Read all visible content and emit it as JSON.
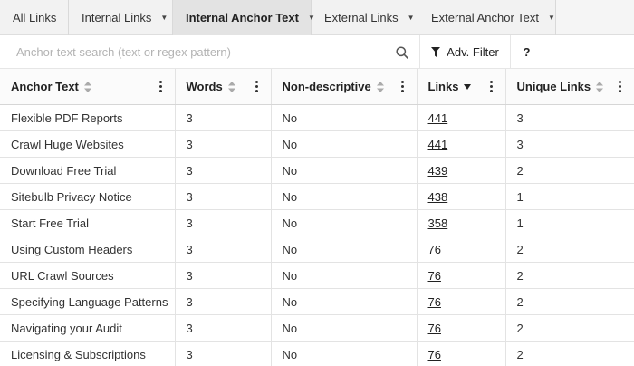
{
  "tabs": [
    {
      "label": "All Links",
      "has_dropdown": false,
      "active": false
    },
    {
      "label": "Internal Links",
      "has_dropdown": true,
      "active": false
    },
    {
      "label": "Internal Anchor Text",
      "has_dropdown": true,
      "active": true
    },
    {
      "label": "External Links",
      "has_dropdown": true,
      "active": false
    },
    {
      "label": "External Anchor Text",
      "has_dropdown": true,
      "active": false
    }
  ],
  "search": {
    "placeholder": "Anchor text search (text or regex pattern)",
    "value": ""
  },
  "toolbar": {
    "filter_label": "Adv. Filter",
    "help_label": "?"
  },
  "table": {
    "columns": [
      {
        "label": "Anchor Text",
        "sort": "none"
      },
      {
        "label": "Words",
        "sort": "none"
      },
      {
        "label": "Non-descriptive",
        "sort": "none"
      },
      {
        "label": "Links",
        "sort": "desc"
      },
      {
        "label": "Unique Links",
        "sort": "none"
      }
    ],
    "rows": [
      {
        "anchor": "Flexible PDF Reports",
        "words": "3",
        "nondesc": "No",
        "links": "441",
        "unique": "3"
      },
      {
        "anchor": "Crawl Huge Websites",
        "words": "3",
        "nondesc": "No",
        "links": "441",
        "unique": "3"
      },
      {
        "anchor": "Download Free Trial",
        "words": "3",
        "nondesc": "No",
        "links": "439",
        "unique": "2"
      },
      {
        "anchor": "Sitebulb Privacy Notice",
        "words": "3",
        "nondesc": "No",
        "links": "438",
        "unique": "1"
      },
      {
        "anchor": "Start Free Trial",
        "words": "3",
        "nondesc": "No",
        "links": "358",
        "unique": "1"
      },
      {
        "anchor": "Using Custom Headers",
        "words": "3",
        "nondesc": "No",
        "links": "76",
        "unique": "2"
      },
      {
        "anchor": "URL Crawl Sources",
        "words": "3",
        "nondesc": "No",
        "links": "76",
        "unique": "2"
      },
      {
        "anchor": "Specifying Language Patterns",
        "words": "3",
        "nondesc": "No",
        "links": "76",
        "unique": "2"
      },
      {
        "anchor": "Navigating your Audit",
        "words": "3",
        "nondesc": "No",
        "links": "76",
        "unique": "2"
      },
      {
        "anchor": "Licensing & Subscriptions",
        "words": "3",
        "nondesc": "No",
        "links": "76",
        "unique": "2"
      }
    ]
  }
}
